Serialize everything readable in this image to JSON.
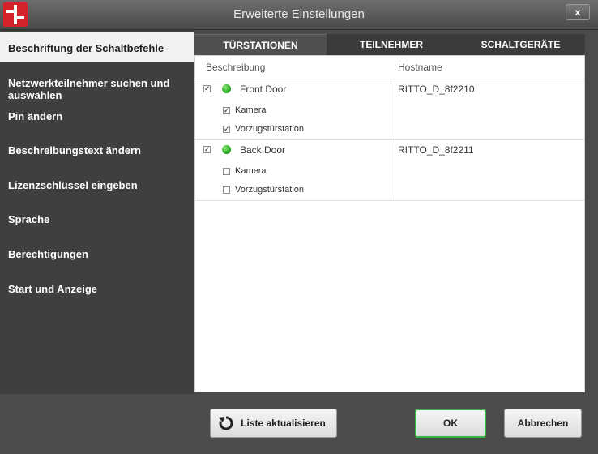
{
  "window": {
    "title": "Erweiterte Einstellungen",
    "close_label": "x"
  },
  "sidebar": {
    "items": [
      {
        "label": "Beschriftung der Schaltbefehle"
      },
      {
        "label": "Netzwerkteilnehmer suchen und auswählen"
      },
      {
        "label": "Pin ändern"
      },
      {
        "label": "Beschreibungstext ändern"
      },
      {
        "label": "Lizenzschlüssel eingeben"
      },
      {
        "label": "Sprache"
      },
      {
        "label": "Berechtigungen"
      },
      {
        "label": "Start und Anzeige"
      }
    ]
  },
  "tabs": [
    {
      "label": "TÜRSTATIONEN",
      "active": true
    },
    {
      "label": "TEILNEHMER",
      "active": false
    },
    {
      "label": "SCHALTGERÄTE",
      "active": false
    }
  ],
  "table": {
    "headers": {
      "description": "Beschreibung",
      "hostname": "Hostname"
    },
    "rows": [
      {
        "name": "Front Door",
        "hostname": "RITTO_D_8f2210",
        "checked": true,
        "status_color": "#2fb52a",
        "options": [
          {
            "label": "Kamera",
            "checked": true
          },
          {
            "label": "Vorzugstürstation",
            "checked": true
          }
        ]
      },
      {
        "name": "Back Door",
        "hostname": "RITTO_D_8f2211",
        "checked": true,
        "status_color": "#2fb52a",
        "options": [
          {
            "label": "Kamera",
            "checked": false
          },
          {
            "label": "Vorzugstürstation",
            "checked": false
          }
        ]
      }
    ]
  },
  "footer": {
    "refresh_label": "Liste aktualisieren",
    "ok_label": "OK",
    "cancel_label": "Abbrechen"
  },
  "colors": {
    "ok_border": "#39b24a",
    "brand_red": "#d3232a"
  }
}
